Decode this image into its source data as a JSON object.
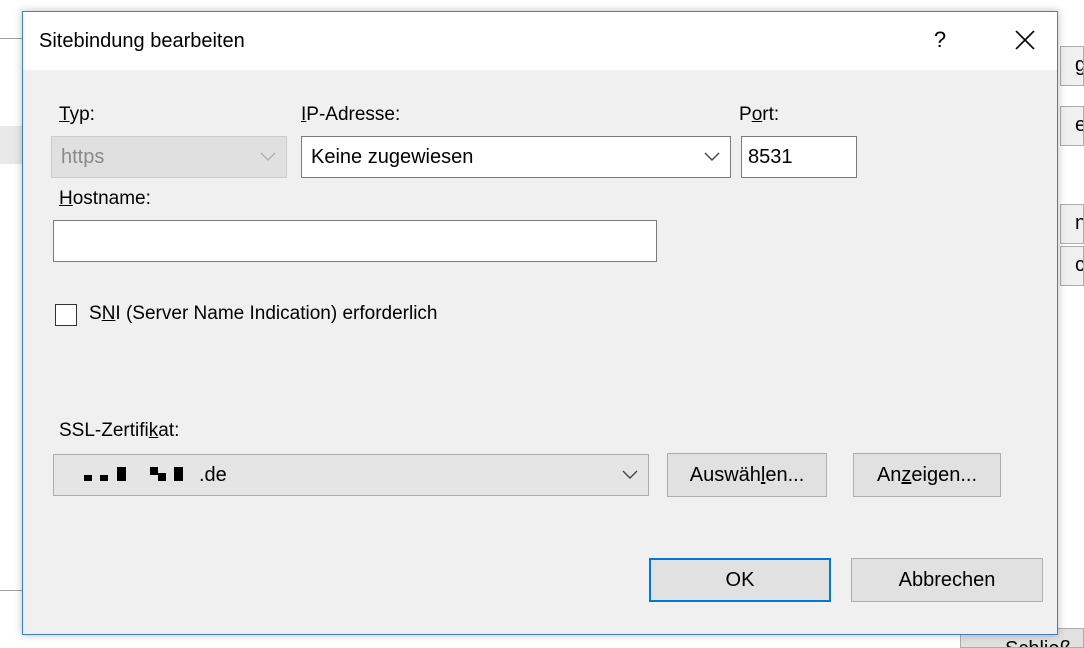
{
  "background": {
    "right_button_chars": [
      "g",
      "e",
      "n",
      "c"
    ],
    "bottom_button_label": "Schließ"
  },
  "dialog": {
    "title": "Sitebindung bearbeiten",
    "help_label": "?",
    "type": {
      "label_prefix": "",
      "label_access": "T",
      "label_rest": "yp:",
      "value": "https"
    },
    "ip": {
      "label_access": "I",
      "label_rest": "P-Adresse:",
      "value": "Keine zugewiesen"
    },
    "port": {
      "label_prefix": "P",
      "label_access": "o",
      "label_rest": "rt:",
      "value": "8531"
    },
    "hostname": {
      "label_access": "H",
      "label_rest": "ostname:",
      "value": ""
    },
    "sni": {
      "label_prefix": "S",
      "label_access": "N",
      "label_rest": "I (Server Name Indication) erforderlich",
      "checked": false
    },
    "ssl": {
      "label_prefix": "SSL-Zertifi",
      "label_access": "k",
      "label_rest": "at:",
      "value_suffix": ".de"
    },
    "buttons": {
      "select_prefix": "Auswäh",
      "select_access": "l",
      "select_rest": "en...",
      "view_prefix": "An",
      "view_access": "z",
      "view_rest": "eigen...",
      "ok": "OK",
      "cancel": "Abbrechen"
    }
  }
}
